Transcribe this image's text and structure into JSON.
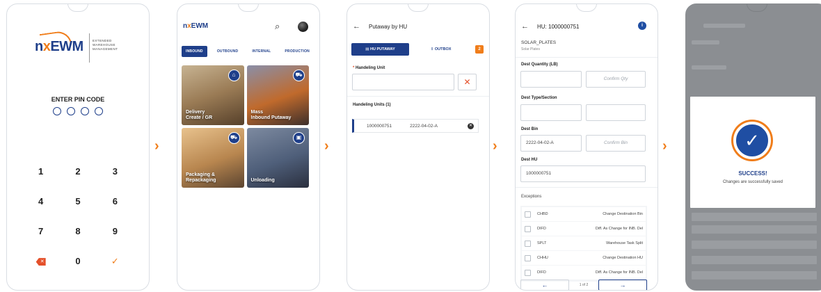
{
  "login": {
    "logo_prefix": "n",
    "logo_x": "x",
    "logo_main": "EWM",
    "logo_tagline_1": "EXTENDED",
    "logo_tagline_2": "WAREHOUSE",
    "logo_tagline_3": "MANAGEMENT",
    "pin_label": "ENTER PIN CODE",
    "keys": [
      "1",
      "2",
      "3",
      "4",
      "5",
      "6",
      "7",
      "8",
      "9",
      "0"
    ]
  },
  "dashboard": {
    "logo_prefix": "n",
    "logo_x": "x",
    "logo_main": "EWM",
    "tabs": [
      "INBOUND",
      "OUTBOUND",
      "INTERNAL",
      "PRODUCTION"
    ],
    "tiles": [
      {
        "label_1": "Delivery",
        "label_2": "Create / GR",
        "icon": "warehouse-icon"
      },
      {
        "label_1": "Mass",
        "label_2": "Inbound Putaway",
        "icon": "forklift-icon"
      },
      {
        "label_1": "Packaging &",
        "label_2": "Repackaging",
        "icon": "truck-icon"
      },
      {
        "label_1": "Unloading",
        "label_2": "",
        "icon": "box-icon"
      }
    ]
  },
  "putaway": {
    "title": "Putaway by HU",
    "tab_hu": "HU PUTAWAY",
    "tab_outbox": "OUTBOX",
    "outbox_count": "2",
    "field_label": "Handeling Unit",
    "list_title": "Handeling Units (1)",
    "hu_number": "1000000751",
    "hu_location": "2222-04-02-A"
  },
  "detail": {
    "title": "HU: 1000000751",
    "material": "SOLAR_PLATES",
    "material_desc": "Solar Plates",
    "qty_label": "Dest Quantity (LB)",
    "qty_confirm_placeholder": "Confirm Qty",
    "type_label": "Dest Type/Section",
    "bin_label": "Dest Bin",
    "bin_value": "2222-04-02-A",
    "bin_confirm_placeholder": "Confirm Bin",
    "hu_label": "Dest HU",
    "hu_value": "1000000751",
    "exceptions_label": "Exceptions",
    "exceptions": [
      {
        "code": "CHBD",
        "desc": "Change Destination Bin"
      },
      {
        "code": "DIFD",
        "desc": "Diff. As Change for INB. Del"
      },
      {
        "code": "SPLT",
        "desc": "Warehouse Task Split"
      },
      {
        "code": "CHHU",
        "desc": "Change Destination HU"
      },
      {
        "code": "DIFD",
        "desc": "Diff. As Change for INB. Del"
      }
    ],
    "pager_text": "1 of 2"
  },
  "success": {
    "title": "SUCCESS!",
    "message": "Changes are successfully saved"
  },
  "colors": {
    "brand_blue": "#1f3f8a",
    "accent_orange": "#f07d1a",
    "danger_red": "#e4502a"
  }
}
